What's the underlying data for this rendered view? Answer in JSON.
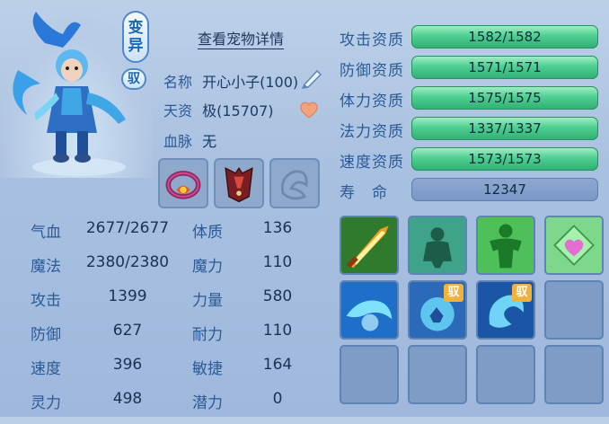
{
  "header": {
    "transform_badge": [
      "变",
      "异"
    ],
    "tame_badge": "驭",
    "detail_link": "查看宠物详情"
  },
  "info": {
    "name_label": "名称",
    "name_value": "开心小子(100)",
    "aptitude_label": "天资",
    "aptitude_value": "极(15707)",
    "bloodline_label": "血脉",
    "bloodline_value": "无"
  },
  "stats": [
    {
      "l1": "气血",
      "v1": "2677/2677",
      "l2": "体质",
      "v2": "136"
    },
    {
      "l1": "魔法",
      "v1": "2380/2380",
      "l2": "魔力",
      "v2": "110"
    },
    {
      "l1": "攻击",
      "v1": "1399",
      "l2": "力量",
      "v2": "580"
    },
    {
      "l1": "防御",
      "v1": "627",
      "l2": "耐力",
      "v2": "110"
    },
    {
      "l1": "速度",
      "v1": "396",
      "l2": "敏捷",
      "v2": "164"
    },
    {
      "l1": "灵力",
      "v1": "498",
      "l2": "潜力",
      "v2": "0"
    }
  ],
  "aptitudes": [
    {
      "label": "攻击资质",
      "value": "1582/1582"
    },
    {
      "label": "防御资质",
      "value": "1571/1571"
    },
    {
      "label": "体力资质",
      "value": "1575/1575"
    },
    {
      "label": "法力资质",
      "value": "1337/1337"
    },
    {
      "label": "速度资质",
      "value": "1573/1573"
    },
    {
      "label": "寿　命",
      "value": "12347"
    }
  ],
  "skills": {
    "tame_tag": "驭"
  },
  "colors": {
    "bar_green": "#4fcf92",
    "life_bar": "#7896c6",
    "label_blue": "#2a5a98"
  }
}
